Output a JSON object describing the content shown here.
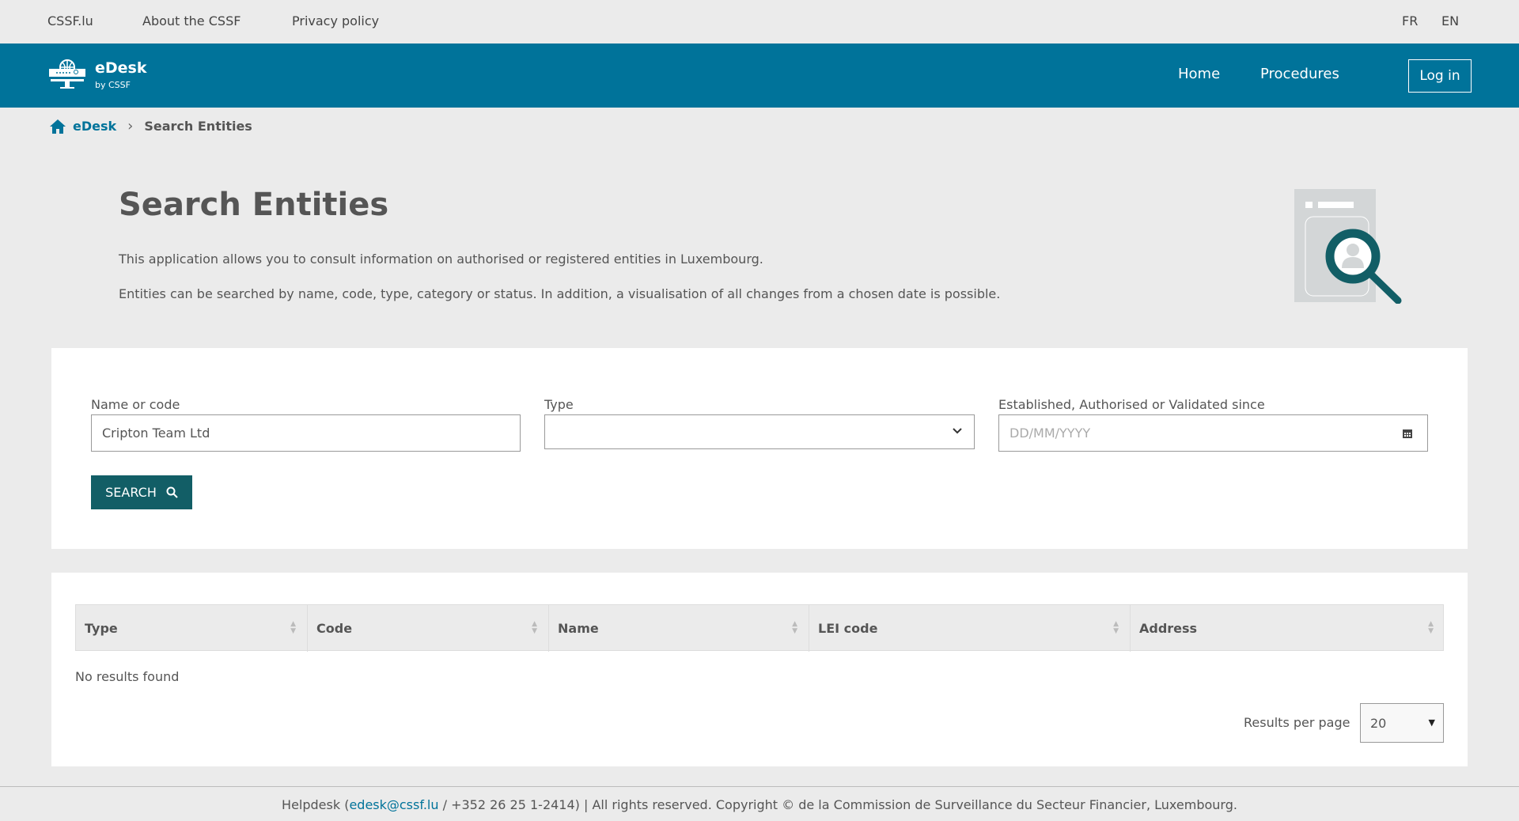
{
  "topbar": {
    "links": [
      "CSSF.lu",
      "About the CSSF",
      "Privacy policy"
    ],
    "languages": [
      "FR",
      "EN"
    ]
  },
  "header": {
    "brand": "eDesk",
    "brand_sub": "by CSSF",
    "nav": [
      "Home",
      "Procedures"
    ],
    "login": "Log in",
    "color": "#00739a"
  },
  "breadcrumb": {
    "home": "eDesk",
    "current": "Search Entities"
  },
  "intro": {
    "title": "Search Entities",
    "p1": "This application allows you to consult information on authorised or registered entities in Luxembourg.",
    "p2": "Entities can be searched by name, code, type, category or status. In addition, a visualisation of all changes from a chosen date is possible."
  },
  "form": {
    "name_label": "Name or code",
    "name_value": "Cripton Team Ltd",
    "type_label": "Type",
    "type_value": "",
    "date_label": "Established, Authorised or Validated since",
    "date_placeholder": "DD/MM/YYYY",
    "search": "SEARCH",
    "button_color": "#125e66"
  },
  "results": {
    "columns": [
      "Type",
      "Code",
      "Name",
      "LEI code",
      "Address"
    ],
    "empty": "No results found",
    "per_page_label": "Results per page",
    "per_page_value": "20"
  },
  "footer": {
    "pre": "Helpdesk (",
    "email": "edesk@cssf.lu",
    "post": " / +352 26 25 1-2414) | All rights reserved. Copyright © de la Commission de Surveillance du Secteur Financier, Luxembourg."
  }
}
